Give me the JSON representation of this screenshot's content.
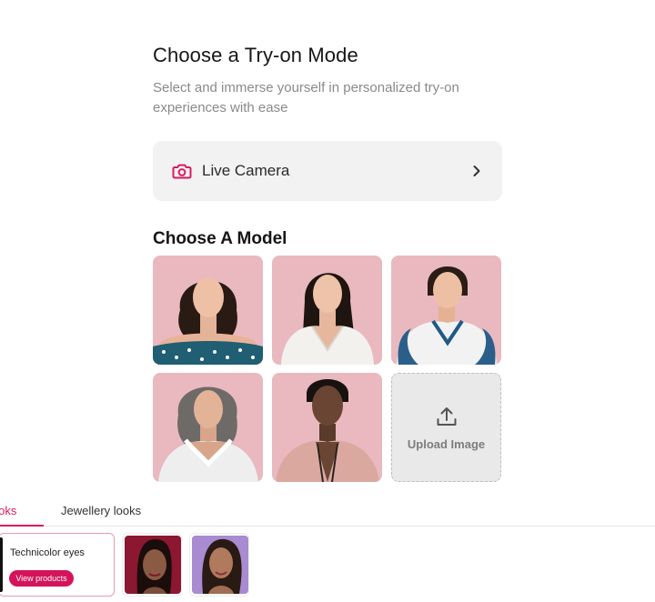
{
  "mode_panel": {
    "title": "Choose a Try-on Mode",
    "subtitle": "Select and immerse yourself in personalized try-on experiences with ease",
    "live_camera_label": "Live Camera",
    "live_camera_icon": "camera-icon",
    "chevron_icon": "chevron-right-icon"
  },
  "models": {
    "heading": "Choose A Model",
    "upload_label": "Upload Image",
    "upload_icon": "upload-icon"
  },
  "tabs": [
    {
      "label": "looks",
      "active": true
    },
    {
      "label": "Jewellery looks",
      "active": false
    }
  ],
  "looks": {
    "card_title": "Technicolor eyes",
    "view_products_label": "View products"
  },
  "colors": {
    "accent": "#d81b60",
    "tile_background": "#e7b8bd",
    "camera_row_background": "#f2f2f2"
  }
}
